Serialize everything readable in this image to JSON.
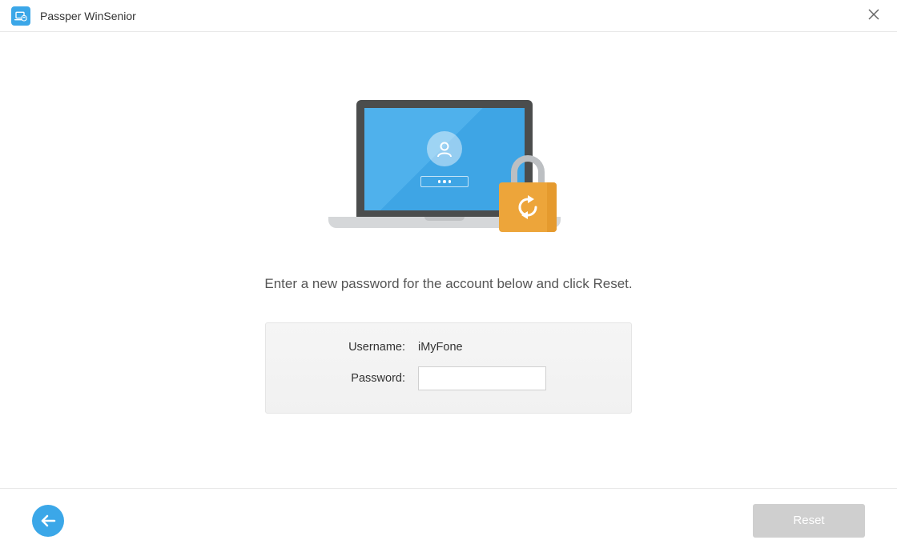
{
  "header": {
    "title": "Passper WinSenior"
  },
  "main": {
    "instruction": "Enter a new password for the account below and click Reset.",
    "username_label": "Username:",
    "username_value": "iMyFone",
    "password_label": "Password:",
    "password_value": ""
  },
  "footer": {
    "reset_label": "Reset"
  }
}
